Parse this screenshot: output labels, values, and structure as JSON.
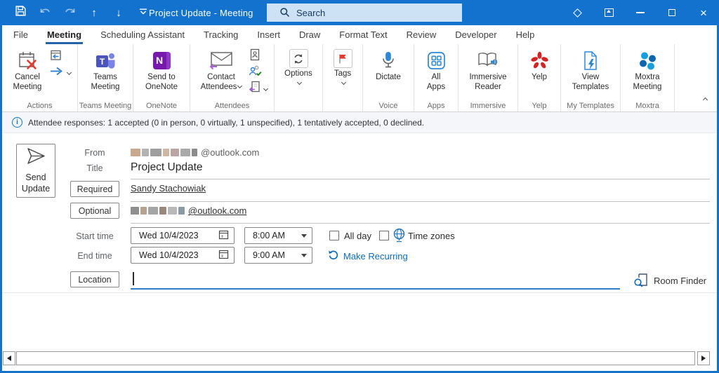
{
  "titlebar": {
    "title": "Project Update - Meeting",
    "search_placeholder": "Search"
  },
  "menubar": {
    "tabs": [
      "File",
      "Meeting",
      "Scheduling Assistant",
      "Tracking",
      "Insert",
      "Draw",
      "Format Text",
      "Review",
      "Developer",
      "Help"
    ],
    "active_tab": "Meeting"
  },
  "ribbon": {
    "groups": [
      {
        "label": "Actions",
        "buttons": [
          "Cancel Meeting"
        ]
      },
      {
        "label": "Teams Meeting",
        "buttons": [
          "Teams Meeting"
        ]
      },
      {
        "label": "OneNote",
        "buttons": [
          "Send to OneNote"
        ]
      },
      {
        "label": "Attendees",
        "buttons": [
          "Contact Attendees"
        ]
      },
      {
        "label": "",
        "buttons": [
          "Options"
        ]
      },
      {
        "label": "",
        "buttons": [
          "Tags"
        ]
      },
      {
        "label": "Voice",
        "buttons": [
          "Dictate"
        ]
      },
      {
        "label": "Apps",
        "buttons": [
          "All Apps"
        ]
      },
      {
        "label": "Immersive",
        "buttons": [
          "Immersive Reader"
        ]
      },
      {
        "label": "Yelp",
        "buttons": [
          "Yelp"
        ]
      },
      {
        "label": "My Templates",
        "buttons": [
          "View Templates"
        ]
      },
      {
        "label": "Moxtra",
        "buttons": [
          "Moxtra Meeting"
        ]
      }
    ]
  },
  "infobar": {
    "message": "Attendee responses: 1 accepted (0 in person, 0 virtually, 1 unspecified), 1 tentatively accepted, 0 declined."
  },
  "form": {
    "send_update_label": "Send Update",
    "from_label": "From",
    "from_domain": "@outlook.com",
    "title_label": "Title",
    "title_value": "Project Update",
    "required_label": "Required",
    "required_value": "Sandy Stachowiak",
    "optional_label": "Optional",
    "optional_domain": "@outlook.com",
    "start_time_label": "Start time",
    "end_time_label": "End time",
    "start_date": "Wed 10/4/2023",
    "start_time": "8:00 AM",
    "end_date": "Wed 10/4/2023",
    "end_time": "9:00 AM",
    "all_day_label": "All day",
    "time_zones_label": "Time zones",
    "make_recurring_label": "Make Recurring",
    "location_label": "Location",
    "room_finder_label": "Room Finder"
  },
  "colors": {
    "titlebar_blue": "#1372ce",
    "accent_link": "#0f6cbd",
    "tab_underline": "#2563a8",
    "search_bg": "#cde2f4",
    "cancel_red": "#e23b2e",
    "yelp_red": "#d32323"
  }
}
